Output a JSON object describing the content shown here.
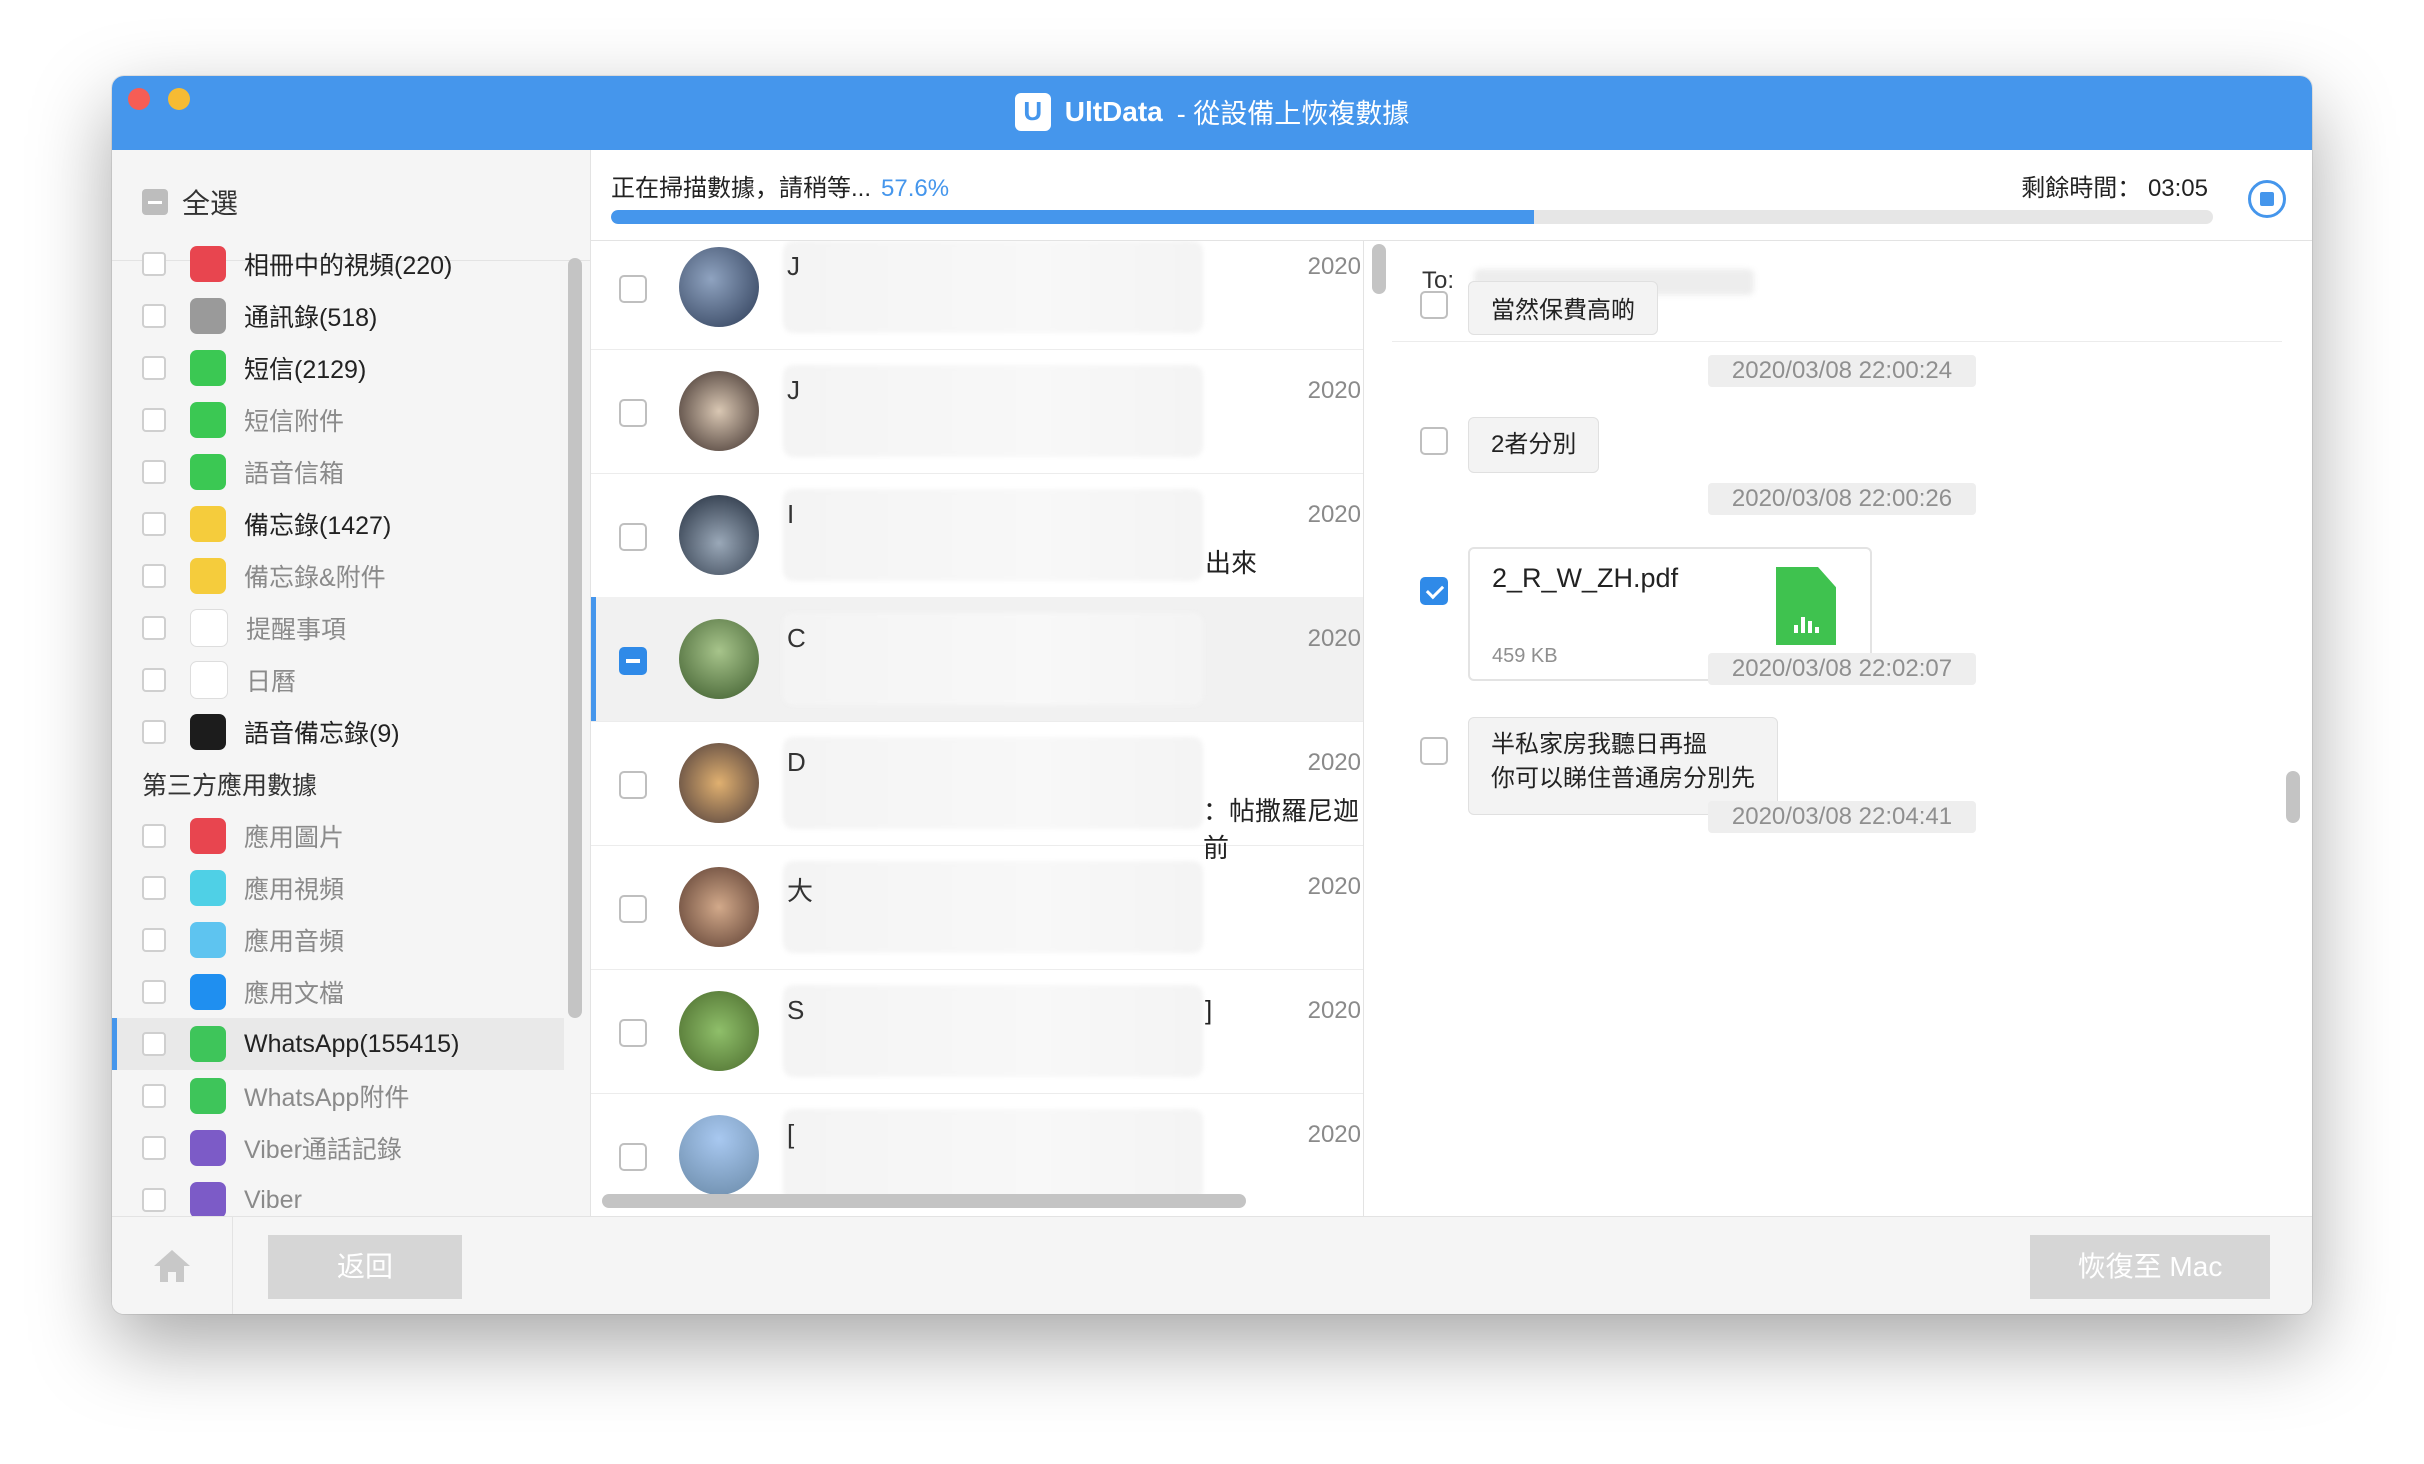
{
  "window": {
    "app_name": "UltData",
    "title_suffix": "- 從設備上恢複數據"
  },
  "sidebar": {
    "select_all_label": "全選",
    "items": [
      {
        "label": "相冊中的視頻(220)",
        "icon": "video-album-icon",
        "color": "#e8454f",
        "dark": true
      },
      {
        "label": "通訊錄(518)",
        "icon": "contacts-icon",
        "color": "#9a9a9a",
        "dark": true
      },
      {
        "label": "短信(2129)",
        "icon": "messages-icon",
        "color": "#3bc853",
        "dark": true
      },
      {
        "label": "短信附件",
        "icon": "message-attachment-icon",
        "color": "#3bc853",
        "dark": false
      },
      {
        "label": "語音信箱",
        "icon": "voicemail-icon",
        "color": "#3bc853",
        "dark": false
      },
      {
        "label": "備忘錄(1427)",
        "icon": "notes-icon",
        "color": "#f5cc3c",
        "dark": true
      },
      {
        "label": "備忘錄&附件",
        "icon": "notes-attachment-icon",
        "color": "#f5cc3c",
        "dark": false
      },
      {
        "label": "提醒事項",
        "icon": "reminders-icon",
        "color": "#ffffff",
        "dark": false
      },
      {
        "label": "日曆",
        "icon": "calendar-icon",
        "color": "#ffffff",
        "dark": false
      },
      {
        "label": "語音備忘錄(9)",
        "icon": "voice-memo-icon",
        "color": "#1c1c1c",
        "dark": true
      }
    ],
    "third_party_heading": "第三方應用數據",
    "third_party_items": [
      {
        "label": "應用圖片",
        "icon": "app-photos-icon",
        "color": "#e8454f",
        "dark": false
      },
      {
        "label": "應用視頻",
        "icon": "app-videos-icon",
        "color": "#4fd0e6",
        "dark": false
      },
      {
        "label": "應用音頻",
        "icon": "app-audio-icon",
        "color": "#5ec4f0",
        "dark": false
      },
      {
        "label": "應用文檔",
        "icon": "app-documents-icon",
        "color": "#1f8ff0",
        "dark": false
      },
      {
        "label": "WhatsApp(155415)",
        "icon": "whatsapp-icon",
        "color": "#3ec55a",
        "dark": true,
        "active": true
      },
      {
        "label": "WhatsApp附件",
        "icon": "whatsapp-attachment-icon",
        "color": "#3ec55a",
        "dark": false
      },
      {
        "label": "Viber通話記錄",
        "icon": "viber-call-icon",
        "color": "#7c5bc7",
        "dark": false
      },
      {
        "label": "Viber",
        "icon": "viber-icon",
        "color": "#7c5bc7",
        "dark": false
      }
    ]
  },
  "progress": {
    "status_text": "正在掃描數據，請稍等...",
    "percent_text": "57.6%",
    "percent": 57.6,
    "remaining_label": "剩餘時間：",
    "remaining_value": "03:05"
  },
  "chats": [
    {
      "initial": "J",
      "tail": "",
      "date": "2020"
    },
    {
      "initial": "J",
      "tail": "",
      "date": "2020"
    },
    {
      "initial": "I",
      "tail": "出來",
      "date": "2020"
    },
    {
      "initial": "C",
      "tail": "",
      "date": "2020",
      "selected": true
    },
    {
      "initial": "D",
      "tail": "：帖撒羅尼迦前",
      "date": "2020"
    },
    {
      "initial": "大",
      "tail": "",
      "date": "2020"
    },
    {
      "initial": "S",
      "tail": "]",
      "date": "2020"
    },
    {
      "initial": "[",
      "tail": "",
      "date": "2020"
    }
  ],
  "messages": {
    "to_label": "To:",
    "msg1_partial": "當然保費高啲",
    "ts1": "2020/03/08 22:00:24",
    "msg2": "2者分別",
    "ts2": "2020/03/08 22:00:26",
    "file_name": "2_R_W_ZH.pdf",
    "file_size": "459 KB",
    "ts3": "2020/03/08 22:02:07",
    "msg3_line1": "半私家房我聽日再搵",
    "msg3_line2": "你可以睇住普通房分別先",
    "ts4": "2020/03/08 22:04:41"
  },
  "footer": {
    "back_label": "返回",
    "recover_label": "恢復至 Mac"
  }
}
